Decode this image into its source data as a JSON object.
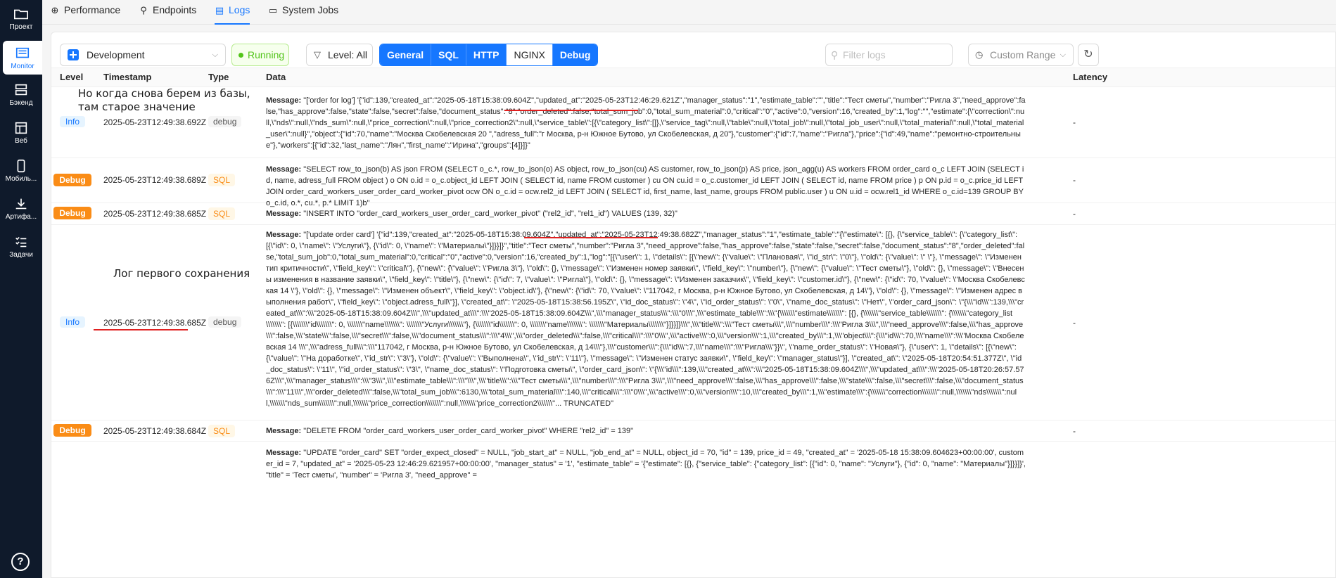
{
  "sidebar": {
    "items": [
      {
        "label": "Проект",
        "icon": "folder-icon"
      },
      {
        "label": "Monitor",
        "icon": "monitor-icon"
      },
      {
        "label": "Бэкенд",
        "icon": "server-icon"
      },
      {
        "label": "Веб",
        "icon": "web-icon"
      },
      {
        "label": "Мобиль...",
        "icon": "mobile-icon"
      },
      {
        "label": "Артифа...",
        "icon": "download-icon"
      },
      {
        "label": "Задачи",
        "icon": "tasks-icon"
      }
    ],
    "help": "?"
  },
  "tabs": [
    {
      "label": "Performance",
      "icon": "⊕"
    },
    {
      "label": "Endpoints",
      "icon": "⚲"
    },
    {
      "label": "Logs",
      "icon": "▤"
    },
    {
      "label": "System Jobs",
      "icon": "▭"
    }
  ],
  "toolbar": {
    "environment": "Development",
    "status": "Running",
    "level": "Level: All",
    "segments": [
      {
        "label": "General",
        "active": true
      },
      {
        "label": "SQL",
        "active": true
      },
      {
        "label": "HTTP",
        "active": true
      },
      {
        "label": "NGINX",
        "active": false
      },
      {
        "label": "Debug",
        "active": true
      }
    ],
    "filter_placeholder": "Filter logs",
    "range": "Custom Range",
    "chevron": "⌵",
    "refresh": "↻"
  },
  "table": {
    "columns": {
      "level": "Level",
      "timestamp": "Timestamp",
      "type": "Type",
      "data": "Data",
      "latency": "Latency"
    },
    "message_label": "Message:",
    "rows": [
      {
        "level": "Info",
        "timestamp": "2025-05-23T12:49:38.692Z",
        "type": "debug",
        "latency": "-",
        "message": "\"['order for log'] '{\"id\":139,\"created_at\":\"2025-05-18T15:38:09.604Z\",\"updated_at\":\"2025-05-23T12:46:29.621Z\",\"manager_status\":\"1\",\"estimate_table\":\"\",\"title\":\"Тест сметы\",\"number\":\"Ригла 3\",\"need_approve\":false,\"has_approve\":false,\"state\":false,\"secret\":false,\"document_status\":\"8\",\"order_deleted\":false,\"total_sum_job\":0,\"total_sum_material\":0,\"critical\":\"0\",\"active\":0,\"version\":16,\"created_by\":1,\"log\":\"\",\"estimate\":{\\\"correction\\\":null,\\\"nds\\\":null,\\\"nds_sum\\\":null,\\\"price_correction\\\":null,\\\"price_correction2\\\":null,\\\"service_table\\\":[{\\\"category_list\\\":[]},\\\"service_tag\\\":null,\\\"table\\\":null,\\\"total_job\\\":null,\\\"total_job_user\\\":null,\\\"total_material\\\":null,\\\"total_material_user\\\":null}\",\"object\":{\"id\":70,\"name\":\"Москва Скобелевская 20 \",\"adress_full\":\"г Москва, р-н Южное Бутово, ул Скобелевская, д 20\"},\"customer\":{\"id\":7,\"name\":\"Ригла\"},\"price\":{\"id\":49,\"name\":\"ремонтно-строительные\"},\"workers\":[{\"id\":32,\"last_name\":\"Лян\",\"first_name\":\"Ирина\",\"groups\":[4]}]}\""
      },
      {
        "level": "Debug",
        "timestamp": "2025-05-23T12:49:38.689Z",
        "type": "SQL",
        "latency": "-",
        "message": "\"SELECT row_to_json(b) AS json FROM (SELECT o_c.*, row_to_json(o) AS object, row_to_json(cu) AS customer, row_to_json(p) AS price, json_agg(u) AS workers FROM order_card o_c LEFT JOIN (SELECT id, name, adress_full FROM object ) o ON o.id = o_c.object_id LEFT JOIN ( SELECT id, name FROM customer ) cu ON cu.id = o_c.customer_id LEFT JOIN ( SELECT id, name FROM price ) p ON p.id = o_c.price_id LEFT JOIN order_card_workers_user_order_card_worker_pivot ocw ON o_c.id = ocw.rel2_id LEFT JOIN ( SELECT id, first_name, last_name, groups FROM public.user ) u ON u.id = ocw.rel1_id WHERE o_c.id=139 GROUP BY o_c.id, o.*, cu.*, p.* LIMIT 1)b\""
      },
      {
        "level": "Debug",
        "timestamp": "2025-05-23T12:49:38.685Z",
        "type": "SQL",
        "latency": "-",
        "message": "\"INSERT INTO \"order_card_workers_user_order_card_worker_pivot\" (\"rel2_id\", \"rel1_id\") VALUES (139, 32)\""
      },
      {
        "level": "Info",
        "timestamp": "2025-05-23T12:49:38.685Z",
        "type": "debug",
        "latency": "-",
        "message": "\"['update order card'] '{\"id\":139,\"created_at\":\"2025-05-18T15:38:09.604Z\",\"updated_at\":\"2025-05-23T12:49:38.682Z\",\"manager_status\":\"1\",\"estimate_table\":\"{\\\"estimate\\\": [{}, {\\\"service_table\\\": {\\\"category_list\\\": [{\\\"id\\\": 0, \\\"name\\\": \\\"Услуги\\\"}, {\\\"id\\\": 0, \\\"name\\\": \\\"Материалы\\\"}]}}]}\",\"title\":\"Тест сметы\",\"number\":\"Ригла 3\",\"need_approve\":false,\"has_approve\":false,\"state\":false,\"secret\":false,\"document_status\":\"8\",\"order_deleted\":false,\"total_sum_job\":0,\"total_sum_material\":0,\"critical\":\"0\",\"active\":0,\"version\":16,\"created_by\":1,\"log\":\"[{\\\"user\\\": 1, \\\"details\\\": [{\\\"new\\\": {\\\"value\\\": \\\"Плановая\\\", \\\"id_str\\\": \\\"0\\\"}, \\\"old\\\": {\\\"value\\\": \\\" \\\"}, \\\"message\\\": \\\"Изменен тип критичности\\\", \\\"field_key\\\": \\\"critical\\\"}, {\\\"new\\\": {\\\"value\\\": \\\"Ригла 3\\\"}, \\\"old\\\": {}, \\\"message\\\": \\\"Изменен номер заявки\\\", \\\"field_key\\\": \\\"number\\\"}, {\\\"new\\\": {\\\"value\\\": \\\"Тест сметы\\\"}, \\\"old\\\": {}, \\\"message\\\": \\\"Внесены изменения в название заявки\\\", \\\"field_key\\\": \\\"title\\\"}, {\\\"new\\\": {\\\"id\\\": 7, \\\"value\\\": \\\"Ригла\\\"}, \\\"old\\\": {}, \\\"message\\\": \\\"Изменен заказчик\\\", \\\"field_key\\\": \\\"customer.id\\\"}, {\\\"new\\\": {\\\"id\\\": 70, \\\"value\\\": \\\"Москва Скобелевская 14 \\\"}, \\\"old\\\": {}, \\\"message\\\": \\\"Изменен объект\\\", \\\"field_key\\\": \\\"object.id\\\"}, {\\\"new\\\": {\\\"id\\\": 70, \\\"value\\\": \\\"117042, г Москва, р-н Южное Бутово, ул Скобелевская, д 14\\\"}, \\\"old\\\": {}, \\\"message\\\": \\\"Изменен адрес выполнения работ\\\", \\\"field_key\\\": \\\"object.adress_full\\\"}], \\\"created_at\\\": \\\"2025-05-18T15:38:56.195Z\\\", \\\"id_doc_status\\\": \\\"4\\\", \\\"id_order_status\\\": \\\"0\\\", \\\"name_doc_status\\\": \\\"Нет\\\", \\\"order_card_json\\\": \\\"{\\\\\\\"id\\\\\\\":139,\\\\\\\"created_at\\\\\\\":\\\\\\\"2025-05-18T15:38:09.604Z\\\\\\\",\\\\\\\"updated_at\\\\\\\":\\\\\\\"2025-05-18T15:38:09.604Z\\\\\\\",\\\\\\\"manager_status\\\\\\\":\\\\\\\"0\\\\\\\",\\\\\\\"estimate_table\\\\\\\":\\\\\\\"{\\\\\\\\\\\\\\\"estimate\\\\\\\\\\\\\\\": [{}, {\\\\\\\\\\\\\\\"service_table\\\\\\\\\\\\\\\": {\\\\\\\\\\\\\\\"category_list\\\\\\\\\\\\\\\": [{\\\\\\\\\\\\\\\"id\\\\\\\\\\\\\\\": 0, \\\\\\\\\\\\\\\"name\\\\\\\\\\\\\\\": \\\\\\\\\\\\\\\"Услуги\\\\\\\\\\\\\\\"}, {\\\\\\\\\\\\\\\"id\\\\\\\\\\\\\\\": 0, \\\\\\\\\\\\\\\"name\\\\\\\\\\\\\\\": \\\\\\\\\\\\\\\"Материалы\\\\\\\\\\\\\\\"}]}}]}\\\\\\\",\\\\\\\"title\\\\\\\":\\\\\\\"Тест сметы\\\\\\\",\\\\\\\"number\\\\\\\":\\\\\\\"Ригла 3\\\\\\\",\\\\\\\"need_approve\\\\\\\":false,\\\\\\\"has_approve\\\\\\\":false,\\\\\\\"state\\\\\\\":false,\\\\\\\"secret\\\\\\\":false,\\\\\\\"document_status\\\\\\\":\\\\\\\"4\\\\\\\",\\\\\\\"order_deleted\\\\\\\":false,\\\\\\\"critical\\\\\\\":\\\\\\\"0\\\\\\\",\\\\\\\"active\\\\\\\":0,\\\\\\\"version\\\\\\\":1,\\\\\\\"created_by\\\\\\\":1,\\\\\\\"object\\\\\\\":{\\\\\\\"id\\\\\\\":70,\\\\\\\"name\\\\\\\":\\\\\\\"Москва Скобелевская 14 \\\\\\\",\\\\\\\"adress_full\\\\\\\":\\\\\\\"117042, г Москва, р-н Южное Бутово, ул Скобелевская, д 14\\\\\\\"},\\\\\\\"customer\\\\\\\":{\\\\\\\"id\\\\\\\":7,\\\\\\\"name\\\\\\\":\\\\\\\"Ригла\\\\\\\"}}\\\", \\\"name_order_status\\\": \\\"Новая\\\"}, {\\\"user\\\": 1, \\\"details\\\": [{\\\"new\\\": {\\\"value\\\": \\\"На доработке\\\", \\\"id_str\\\": \\\"3\\\"}, \\\"old\\\": {\\\"value\\\": \\\"Выполнена\\\", \\\"id_str\\\": \\\"11\\\"}, \\\"message\\\": \\\"Изменен статус заявки\\\", \\\"field_key\\\": \\\"manager_status\\\"}], \\\"created_at\\\": \\\"2025-05-18T20:54:51.377Z\\\", \\\"id_doc_status\\\": \\\"11\\\", \\\"id_order_status\\\": \\\"3\\\", \\\"name_doc_status\\\": \\\"Подготовка сметы\\\", \\\"order_card_json\\\": \\\"{\\\\\\\"id\\\\\\\":139,\\\\\\\"created_at\\\\\\\":\\\\\\\"2025-05-18T15:38:09.604Z\\\\\\\",\\\\\\\"updated_at\\\\\\\":\\\\\\\"2025-05-18T20:26:57.576Z\\\\\\\",\\\\\\\"manager_status\\\\\\\":\\\\\\\"3\\\\\\\",\\\\\\\"estimate_table\\\\\\\":\\\\\\\"\\\\\\\",\\\\\\\"title\\\\\\\":\\\\\\\"Тест сметы\\\\\\\",\\\\\\\"number\\\\\\\":\\\\\\\"Ригла 3\\\\\\\",\\\\\\\"need_approve\\\\\\\":false,\\\\\\\"has_approve\\\\\\\":false,\\\\\\\"state\\\\\\\":false,\\\\\\\"secret\\\\\\\":false,\\\\\\\"document_status\\\\\\\":\\\\\\\"11\\\\\\\",\\\\\\\"order_deleted\\\\\\\":false,\\\\\\\"total_sum_job\\\\\\\":6130,\\\\\\\"total_sum_material\\\\\\\":140,\\\\\\\"critical\\\\\\\":\\\\\\\"0\\\\\\\",\\\\\\\"active\\\\\\\":0,\\\\\\\"version\\\\\\\":10,\\\\\\\"created_by\\\\\\\":1,\\\\\\\"estimate\\\\\\\":{\\\\\\\\\\\\\\\"correction\\\\\\\\\\\\\\\":null,\\\\\\\\\\\\\\\"nds\\\\\\\\\\\\\\\":null,\\\\\\\\\\\\\\\"nds_sum\\\\\\\\\\\\\\\":null,\\\\\\\\\\\\\\\"price_correction\\\\\\\\\\\\\\\":null,\\\\\\\\\\\\\\\"price_correction2\\\\\\\\\\\\\\\"... TRUNCATED\""
      },
      {
        "level": "Debug",
        "timestamp": "2025-05-23T12:49:38.684Z",
        "type": "SQL",
        "latency": "-",
        "message": "\"DELETE FROM \"order_card_workers_user_order_card_worker_pivot\" WHERE \"rel2_id\" = 139\""
      },
      {
        "level": "",
        "timestamp": "",
        "type": "",
        "latency": "",
        "message": "\"UPDATE \"order_card\" SET \"order_expect_closed\" = NULL, \"job_start_at\" = NULL, \"job_end_at\" = NULL, object_id = 70, \"id\" = 139, price_id = 49, \"created_at\" = '2025-05-18 15:38:09.604623+00:00:00', customer_id = 7, \"updated_at\" = '2025-05-23 12:46:29.621957+00:00:00', \"manager_status\" = '1', \"estimate_table\" = '{\"estimate\": [{}, {\"service_table\": {\"category_list\": [{\"id\": 0, \"name\": \"Услуги\"}, {\"id\": 0, \"name\": \"Материалы\"}]}}]}', \"title\" = 'Тест сметы', \"number\" = 'Ригла 3', \"need_approve\" ="
      }
    ]
  },
  "annotations": {
    "note1_line1": "Но когда снова берем из базы,",
    "note1_line2": "там старое значение",
    "note2": "Лог первого сохранения"
  },
  "colors": {
    "accent": "#1677ff",
    "debug": "#fa8c16",
    "running": "#52c41a",
    "annotation": "#e02020"
  }
}
